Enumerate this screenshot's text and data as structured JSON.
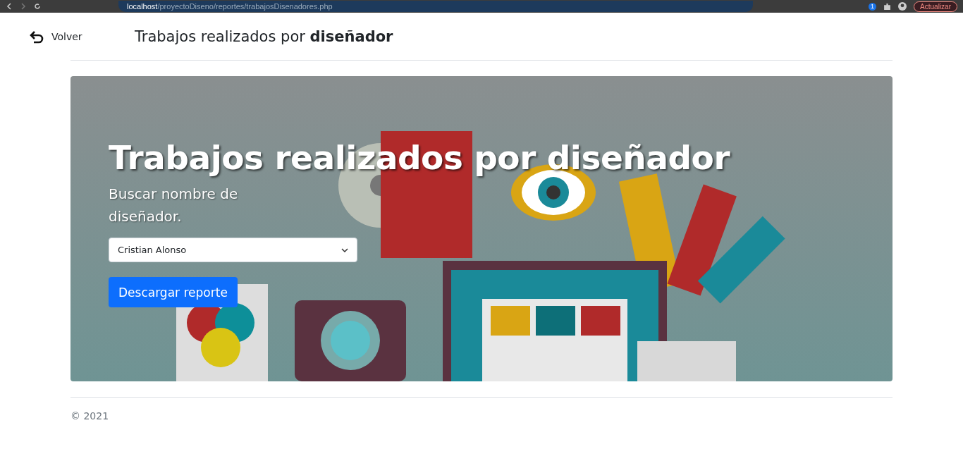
{
  "browser": {
    "url_host": "localhost",
    "url_path": "/proyectoDiseno/reportes/trabajosDisenadores.php",
    "extension_badge": "1",
    "update_button": "Actualizar"
  },
  "header": {
    "back_link": "Volver",
    "title": "Trabajos realizados por **diseñador**"
  },
  "hero": {
    "title": "Trabajos realizados por diseñador",
    "subtitle": "Buscar nombre de diseñador.",
    "select": {
      "value": "Cristian Alonso"
    },
    "button": "Descargar reporte"
  },
  "footer": {
    "copyright": "© 2021"
  }
}
